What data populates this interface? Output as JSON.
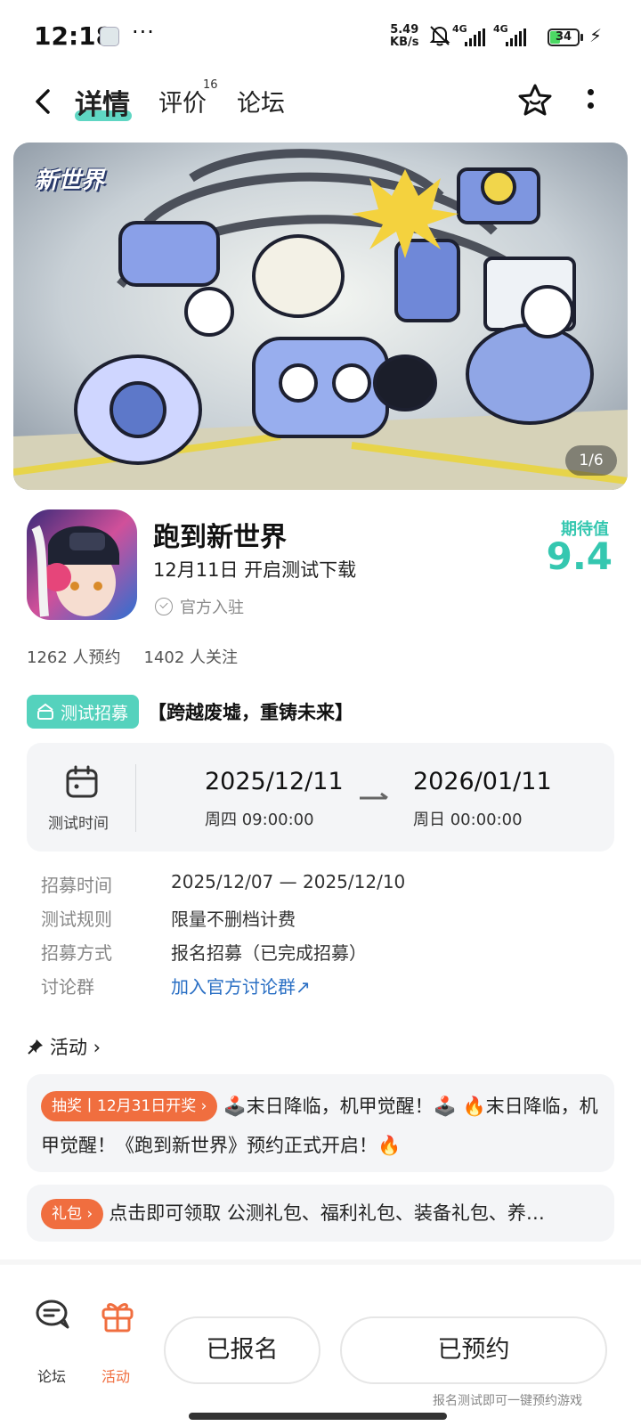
{
  "status_bar": {
    "time": "12:18",
    "more": "···",
    "net_speed_value": "5.49",
    "net_speed_unit": "KB/s",
    "signal1_label": "4G",
    "signal2_label": "4G",
    "battery": "34",
    "icons": [
      "app-icon",
      "bell-muted-icon",
      "signal-icon",
      "battery-icon",
      "charging-icon"
    ]
  },
  "header": {
    "tabs": [
      {
        "label": "详情",
        "active": true
      },
      {
        "label": "评价",
        "badge": "16"
      },
      {
        "label": "论坛"
      }
    ],
    "icons": [
      "back-icon",
      "star-icon",
      "more-vertical-icon"
    ],
    "accent": "#5fd6c3"
  },
  "banner": {
    "logo_text": "新世界",
    "page_indicator": "1/6"
  },
  "app": {
    "name": "跑到新世界",
    "date_line": "12月11日 开启测试下载",
    "official": "官方入驻",
    "score_label": "期待值",
    "score": "9.4",
    "score_color": "#35c7b0",
    "stats": [
      "1262 人预约",
      "1402 人关注"
    ]
  },
  "recruit": {
    "badge": "测试招募",
    "title": "【跨越废墟，重铸未来】",
    "time_label": "测试时间",
    "start_date": "2025/12/11",
    "start_time": "周四  09:00:00",
    "end_date": "2026/01/11",
    "end_time": "周日  00:00:00",
    "rows": [
      {
        "k": "招募时间",
        "v": "2025/12/07 — 2025/12/10"
      },
      {
        "k": "测试规则",
        "v": "限量不删档计费"
      },
      {
        "k": "招募方式",
        "v": "报名招募（已完成招募）"
      },
      {
        "k": "讨论群",
        "v": "加入官方讨论群↗"
      }
    ]
  },
  "activity": {
    "heading": "活动 ›",
    "lottery_pill": "抽奖丨12月31日开奖 ›",
    "lottery_text": "🕹️末日降临，机甲觉醒！🕹️ 🔥末日降临，机甲觉醒！《跑到新世界》预约正式开启！🔥",
    "gift_pill": "礼包 ›",
    "gift_text": "点击即可领取 公测礼包、福利礼包、装备礼包、养…",
    "pill_color": "#f06e3f"
  },
  "bottom_bar": {
    "forum_label": "论坛",
    "activity_label": "活动",
    "activity_color": "#f06e3f",
    "signed_up": "已报名",
    "reserved": "已预约",
    "hint": "报名测试即可一键预约游戏"
  }
}
